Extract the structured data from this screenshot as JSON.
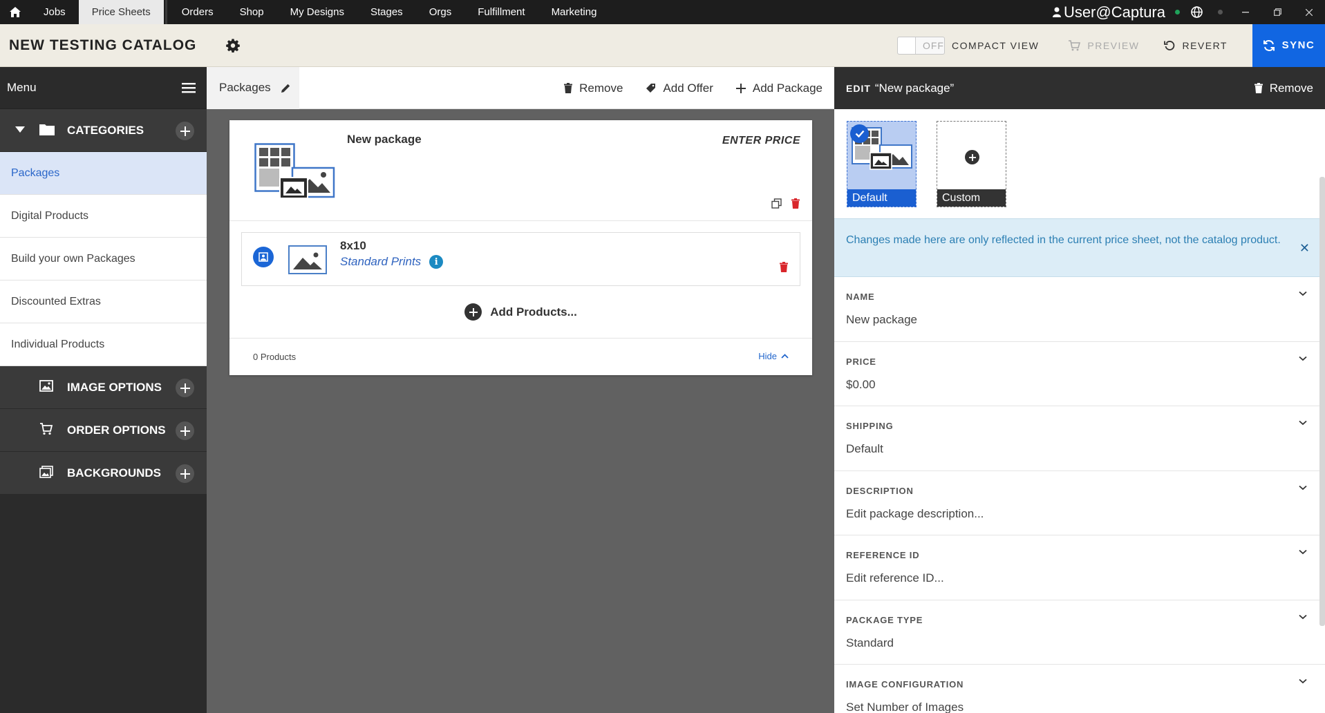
{
  "topnav": {
    "tabs": [
      "Jobs",
      "Price Sheets",
      "Orders",
      "Shop",
      "My Designs",
      "Stages",
      "Orgs",
      "Fulfillment",
      "Marketing"
    ],
    "active_tab": "Price Sheets",
    "user": "User@Captura"
  },
  "header": {
    "title": "NEW TESTING CATALOG",
    "toggle_state": "OFF",
    "compact_view_label": "COMPACT VIEW",
    "preview_label": "PREVIEW",
    "revert_label": "REVERT",
    "sync_label": "SYNC"
  },
  "sidebar": {
    "menu_label": "Menu",
    "categories_label": "CATEGORIES",
    "items": [
      {
        "label": "Packages",
        "active": true
      },
      {
        "label": "Digital Products",
        "active": false
      },
      {
        "label": "Build your own Packages",
        "active": false
      },
      {
        "label": "Discounted Extras",
        "active": false
      },
      {
        "label": "Individual Products",
        "active": false
      }
    ],
    "sections": [
      {
        "label": "IMAGE OPTIONS",
        "icon": "image-icon"
      },
      {
        "label": "ORDER OPTIONS",
        "icon": "cart-icon"
      },
      {
        "label": "BACKGROUNDS",
        "icon": "backgrounds-icon"
      }
    ]
  },
  "midbar": {
    "tab_label": "Packages",
    "remove_label": "Remove",
    "add_offer_label": "Add Offer",
    "add_package_label": "Add Package"
  },
  "package": {
    "name": "New package",
    "price_label": "ENTER PRICE",
    "product": {
      "name": "8x10",
      "type": "Standard Prints"
    },
    "add_products_label": "Add Products...",
    "count_label": "0 Products",
    "hide_label": "Hide"
  },
  "edit_panel": {
    "title_prefix": "EDIT",
    "title_name": "“New package”",
    "remove_label": "Remove",
    "image_options": [
      {
        "label": "Default",
        "selected": true
      },
      {
        "label": "Custom",
        "selected": false
      }
    ],
    "notice": "Changes made here are only reflected in the current price sheet, not the catalog product.",
    "fields": [
      {
        "label": "NAME",
        "value": "New package"
      },
      {
        "label": "PRICE",
        "value": "$0.00"
      },
      {
        "label": "SHIPPING",
        "value": "Default"
      },
      {
        "label": "DESCRIPTION",
        "value": "Edit package description..."
      },
      {
        "label": "REFERENCE ID",
        "value": "Edit reference ID..."
      },
      {
        "label": "PACKAGE TYPE",
        "value": "Standard"
      },
      {
        "label": "IMAGE CONFIGURATION",
        "value": "Set Number of Images"
      }
    ]
  },
  "colors": {
    "accent": "#1166e2",
    "sidebar_bg": "#2b2b2b",
    "active_item_bg": "#dbe5f7",
    "notice_bg": "#dcedf7",
    "delete_red": "#d9262b"
  }
}
